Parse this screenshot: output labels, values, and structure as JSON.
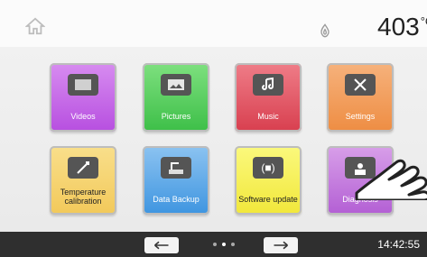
{
  "header": {
    "temperature": "403",
    "unit": "°C",
    "icons": [
      "home-icon",
      "flame-icon"
    ]
  },
  "tiles": [
    {
      "label": "Videos",
      "color": "#c45ee2",
      "icon": "video-icon"
    },
    {
      "label": "Pictures",
      "color": "#4ecb56",
      "icon": "pictures-icon"
    },
    {
      "label": "Music",
      "color": "#e14a58",
      "icon": "music-icon"
    },
    {
      "label": "Settings",
      "color": "#f29b50",
      "icon": "tools-icon"
    },
    {
      "label": "Temperature calibration",
      "color": "#f6d36a",
      "icon": "calibration-icon"
    },
    {
      "label": "Data Backup",
      "color": "#5aa7e6",
      "icon": "data-backup-icon"
    },
    {
      "label": "Software update",
      "color": "#f5f24e",
      "icon": "software-update-icon"
    },
    {
      "label": "Diagnosis",
      "color": "#b46ed3",
      "icon": "diagnosis-icon"
    }
  ],
  "footer": {
    "time": "14:42:55",
    "pagination": {
      "current": 2,
      "total": 3
    }
  }
}
